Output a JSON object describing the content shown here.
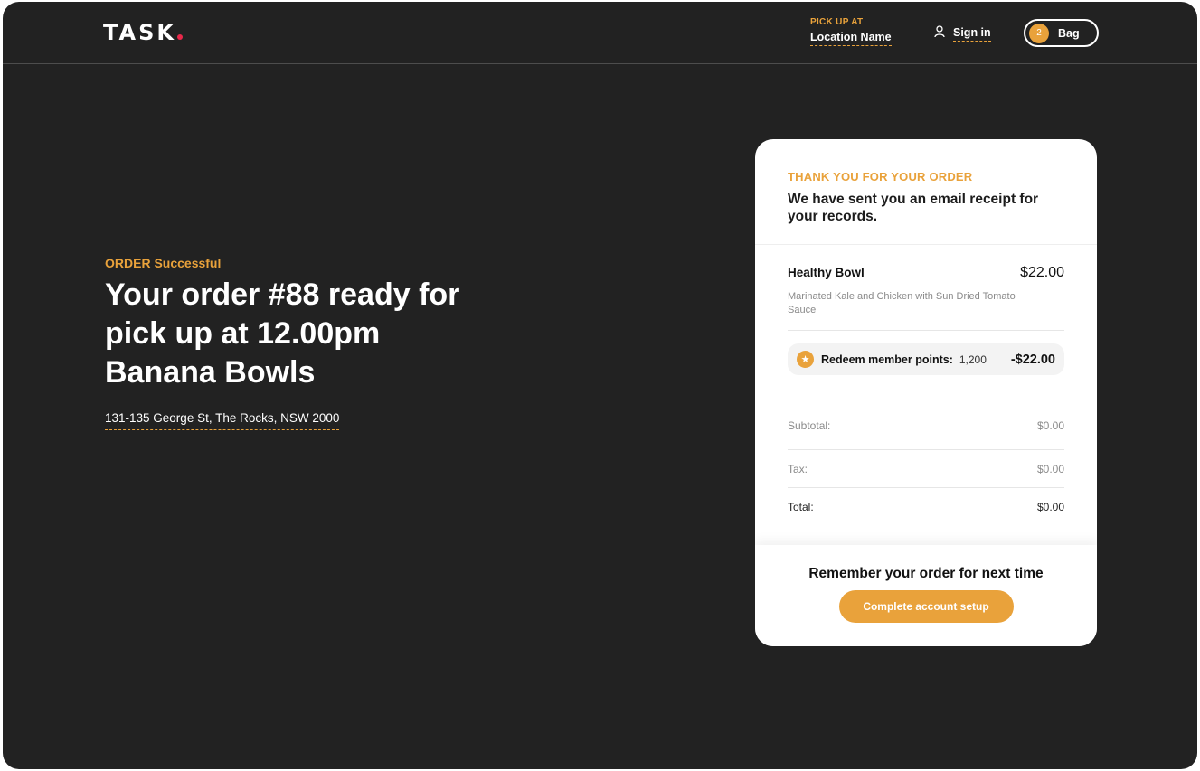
{
  "header": {
    "logo": "TASK",
    "pickup_label": "PICK UP AT",
    "pickup_location": "Location Name",
    "signin_label": "Sign in",
    "bag_count": "2",
    "bag_label": "Bag"
  },
  "hero": {
    "eyebrow": "ORDER Successful",
    "title": "Your order #88 ready for pick up at 12.00pm Banana Bowls",
    "address": "131-135 George St, The Rocks, NSW 2000"
  },
  "receipt": {
    "thanks": "THANK YOU FOR YOUR ORDER",
    "email_message": "We have sent you an email receipt for your records.",
    "item": {
      "name": "Healthy Bowl",
      "price": "$22.00",
      "description": "Marinated Kale and Chicken with Sun Dried Tomato Sauce"
    },
    "redeem": {
      "label": "Redeem member points:",
      "points": "1,200",
      "amount": "-$22.00"
    },
    "totals": [
      {
        "label": "Subtotal:",
        "value": "$0.00"
      },
      {
        "label": "Tax:",
        "value": "$0.00"
      },
      {
        "label": "Total:",
        "value": "$0.00"
      }
    ],
    "remember": "Remember your order for next time",
    "cta_label": "Complete account setup"
  },
  "colors": {
    "background": "#222222",
    "accent": "#e9a23b",
    "logo_dot": "#e8284a",
    "card": "#ffffff"
  },
  "icons": [
    "user-icon",
    "star-icon"
  ]
}
